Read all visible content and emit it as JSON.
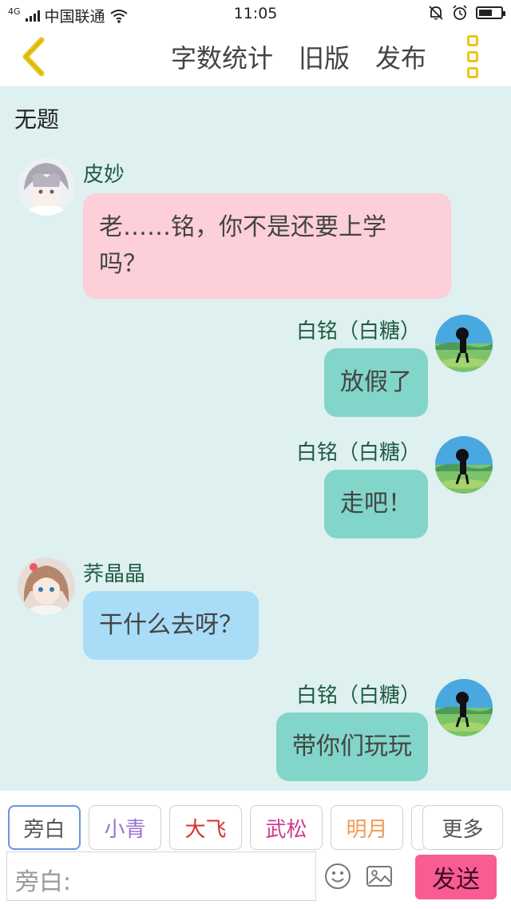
{
  "status_bar": {
    "network": "4G",
    "carrier": "中国联通",
    "time": "11:05",
    "battery_level": 0.6
  },
  "nav": {
    "items": [
      "字数统计",
      "旧版",
      "发布"
    ],
    "accent": "#e8c617"
  },
  "story_title": "无题",
  "messages": [
    {
      "side": "left",
      "name": "皮妙",
      "lines": [
        "老……铭，你不是还要上学",
        "吗？"
      ],
      "color": "#fccfd9"
    },
    {
      "side": "right",
      "name": "白铭（白糖）",
      "lines": [
        "放假了"
      ],
      "color": "#82d5c9"
    },
    {
      "side": "right",
      "name": "白铭（白糖）",
      "lines": [
        "走吧！"
      ],
      "color": "#82d5c9"
    },
    {
      "side": "left",
      "name": "荞晶晶",
      "lines": [
        "干什么去呀？"
      ],
      "color": "#a8dcf7"
    },
    {
      "side": "right",
      "name": "白铭（白糖）",
      "lines": [
        "带你们玩玩"
      ],
      "color": "#82d5c9"
    }
  ],
  "roles": [
    {
      "label": "旁白",
      "color": "#555555"
    },
    {
      "label": "小青",
      "color": "#9a6fd0"
    },
    {
      "label": "大飞",
      "color": "#d9302a"
    },
    {
      "label": "武松",
      "color": "#d13c8f"
    },
    {
      "label": "明月",
      "color": "#f09a55"
    }
  ],
  "more_label": "更多",
  "input": {
    "placeholder": "旁白:"
  },
  "send_label": "发送",
  "send_color": "#f85c93"
}
